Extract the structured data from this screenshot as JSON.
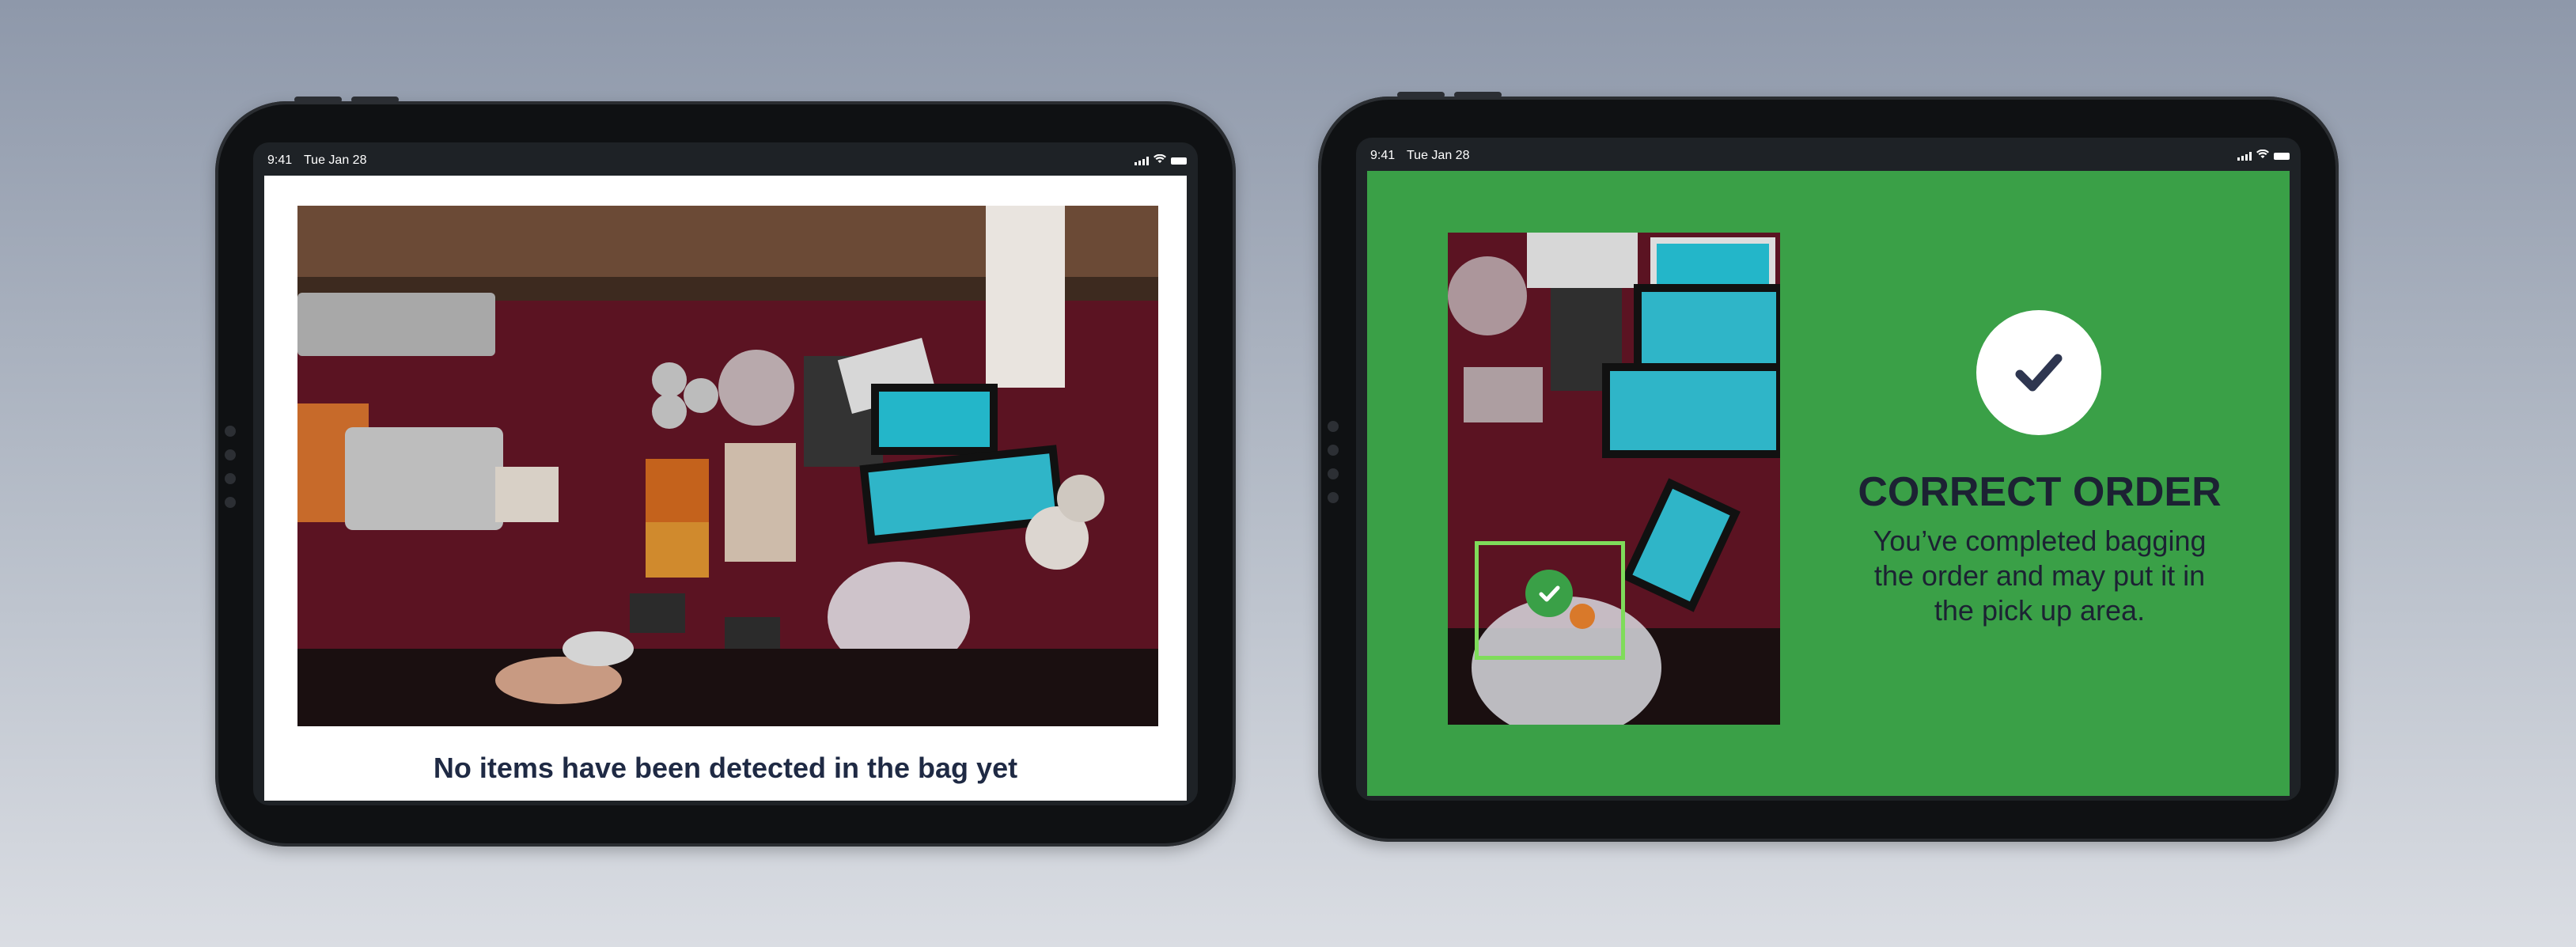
{
  "colors": {
    "success_green": "#3aa047",
    "detection_box": "#7fdc5a",
    "caption_text": "#1f2a44",
    "check_mark": "#2e3650"
  },
  "left_device": {
    "status_bar": {
      "time": "9:41",
      "date": "Tue Jan 28"
    },
    "camera_feed_icon": "overhead-camera-feed",
    "caption": "No items have been detected in the bag yet"
  },
  "right_device": {
    "status_bar": {
      "time": "9:41",
      "date": "Tue Jan 28"
    },
    "camera_feed_icon": "overhead-camera-feed",
    "detection_icon": "check-circle-icon",
    "result_icon": "checkmark-icon",
    "title": "CORRECT ORDER",
    "message": "You’ve completed bagging the order and may put it in the pick up area."
  }
}
